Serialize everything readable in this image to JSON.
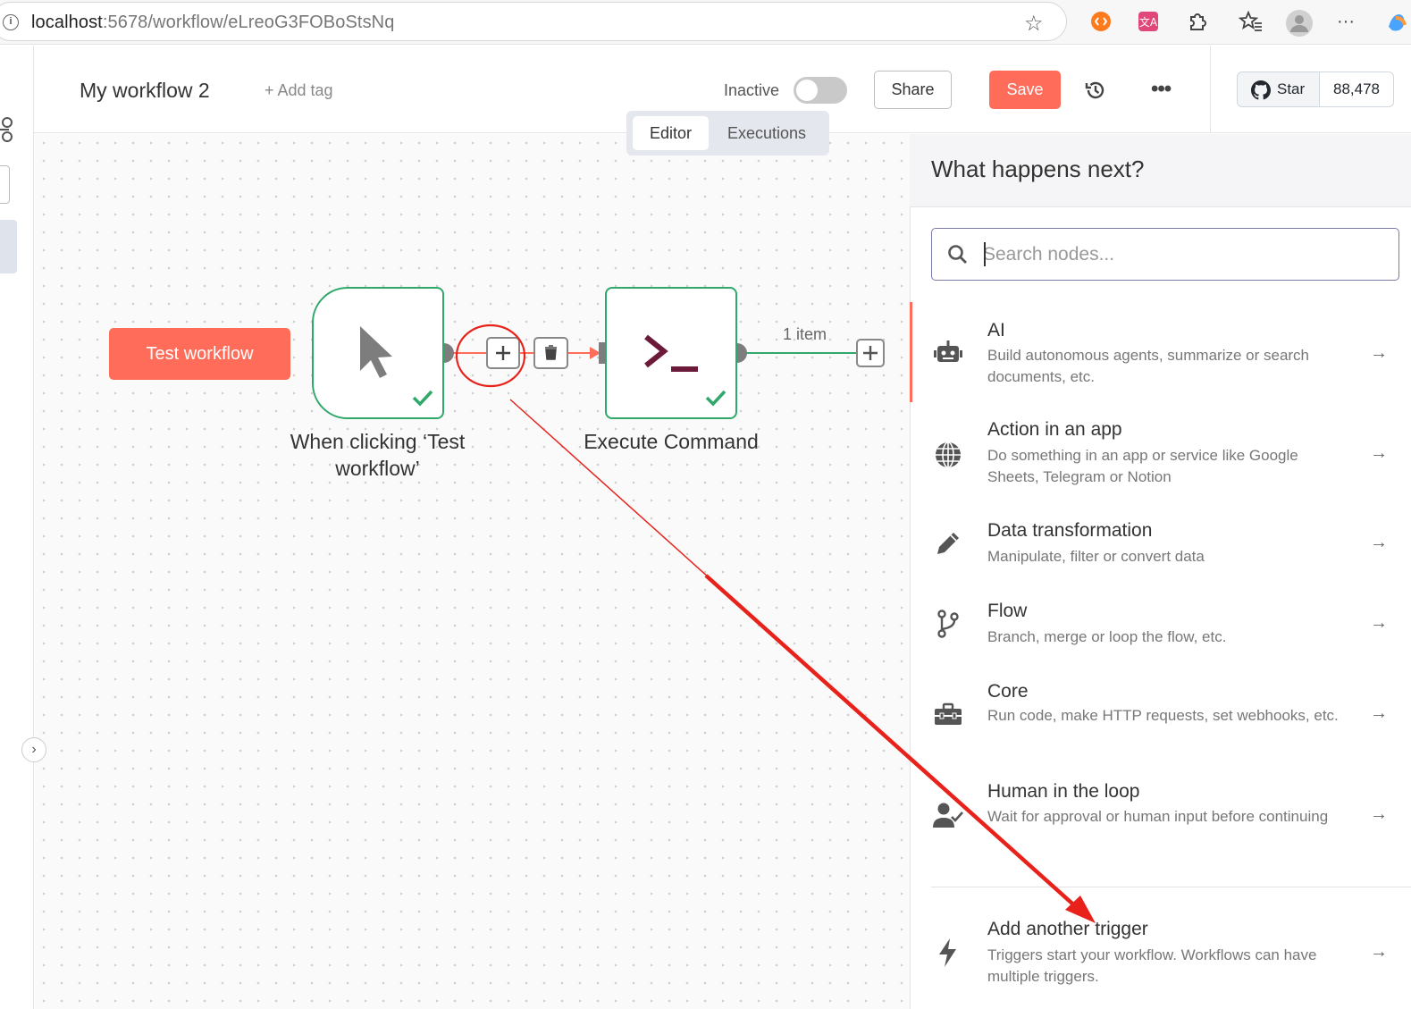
{
  "browser": {
    "url_host": "localhost",
    "url_path": ":5678/workflow/eLreoG3FOBoStsNq"
  },
  "header": {
    "workflow_title": "My workflow 2",
    "add_tag": "+ Add tag",
    "inactive_label": "Inactive",
    "share_label": "Share",
    "save_label": "Save",
    "github_star_label": "Star",
    "github_star_count": "88,478"
  },
  "tabs": [
    {
      "label": "Editor",
      "active": true
    },
    {
      "label": "Executions",
      "active": false
    }
  ],
  "canvas": {
    "test_button": "Test workflow",
    "nodes": [
      {
        "label": "When clicking ‘Test workflow’",
        "icon": "cursor-icon",
        "status": "success"
      },
      {
        "label": "Execute Command",
        "icon": "terminal-icon",
        "status": "success"
      }
    ],
    "item_count": "1 item"
  },
  "panel": {
    "title": "What happens next?",
    "search_placeholder": "Search nodes...",
    "categories": [
      {
        "title": "AI",
        "desc": "Build autonomous agents, summarize or search documents, etc.",
        "icon": "robot-icon"
      },
      {
        "title": "Action in an app",
        "desc": "Do something in an app or service like Google Sheets, Telegram or Notion",
        "icon": "globe-icon"
      },
      {
        "title": "Data transformation",
        "desc": "Manipulate, filter or convert data",
        "icon": "pen-icon"
      },
      {
        "title": "Flow",
        "desc": "Branch, merge or loop the flow, etc.",
        "icon": "branch-icon"
      },
      {
        "title": "Core",
        "desc": "Run code, make HTTP requests, set webhooks, etc.",
        "icon": "toolbox-icon"
      },
      {
        "title": "Human in the loop",
        "desc": "Wait for approval or human input before continuing",
        "icon": "user-check-icon"
      },
      {
        "title": "Add another trigger",
        "desc": "Triggers start your workflow. Workflows can have multiple triggers.",
        "icon": "bolt-icon"
      }
    ]
  },
  "colors": {
    "accent": "#ff6d5a",
    "node_border": "#2fa86a",
    "annotation": "#e8221b"
  }
}
